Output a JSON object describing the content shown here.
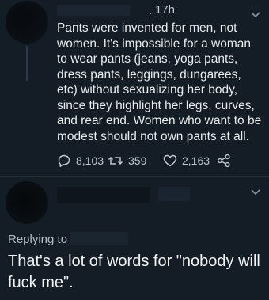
{
  "tweet": {
    "timestamp": "17h",
    "text": "Pants were invented for men, not women. It's impossible for a woman to wear pants (jeans, yoga pants, dress pants, leggings, dungarees, etc) without sexualizing her body, since they highlight her legs, curves, and rear end. Women who want to be modest should not own pants at all.",
    "replies": "8,103",
    "retweets": "359",
    "likes": "2,163"
  },
  "reply": {
    "replying_to_label": "Replying to",
    "text": "That's a lot of words for \"nobody will fuck me\"."
  },
  "colors": {
    "background": "#141d26",
    "text": "#e9ecef",
    "muted": "#8899a6"
  }
}
